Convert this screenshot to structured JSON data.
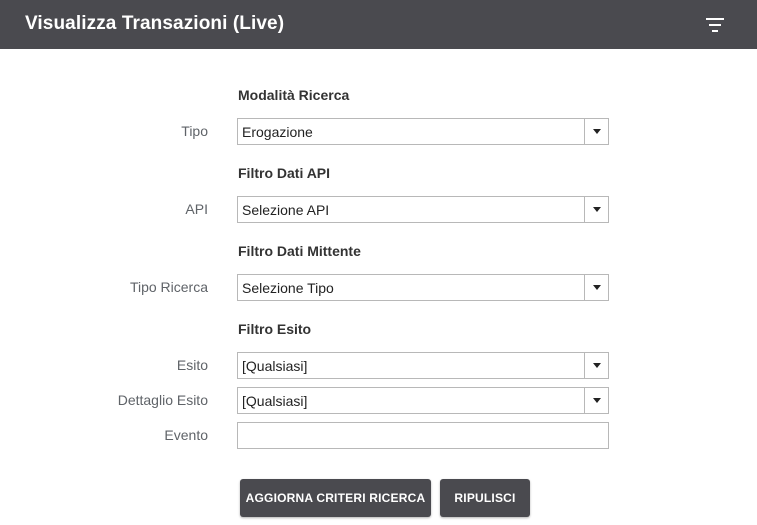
{
  "header": {
    "title": "Visualizza Transazioni (Live)",
    "filter_icon": "filter-list-icon"
  },
  "sections": {
    "modalita": {
      "title": "Modalità Ricerca"
    },
    "api": {
      "title": "Filtro Dati API"
    },
    "mittente": {
      "title": "Filtro Dati Mittente"
    },
    "esito": {
      "title": "Filtro Esito"
    }
  },
  "fields": {
    "tipo": {
      "label": "Tipo",
      "value": "Erogazione"
    },
    "api": {
      "label": "API",
      "value": "Selezione API"
    },
    "tipo_ricerca": {
      "label": "Tipo Ricerca",
      "value": "Selezione Tipo"
    },
    "esito": {
      "label": "Esito",
      "value": "[Qualsiasi]"
    },
    "dettaglio_esito": {
      "label": "Dettaglio Esito",
      "value": "[Qualsiasi]"
    },
    "evento": {
      "label": "Evento",
      "value": ""
    }
  },
  "buttons": {
    "aggiorna": "AGGIORNA CRITERI RICERCA",
    "ripulisci": "RIPULISCI"
  },
  "colors": {
    "header_bg": "#4a4a4f",
    "button_bg": "#4a4a4f",
    "label_text": "#5f6368"
  }
}
